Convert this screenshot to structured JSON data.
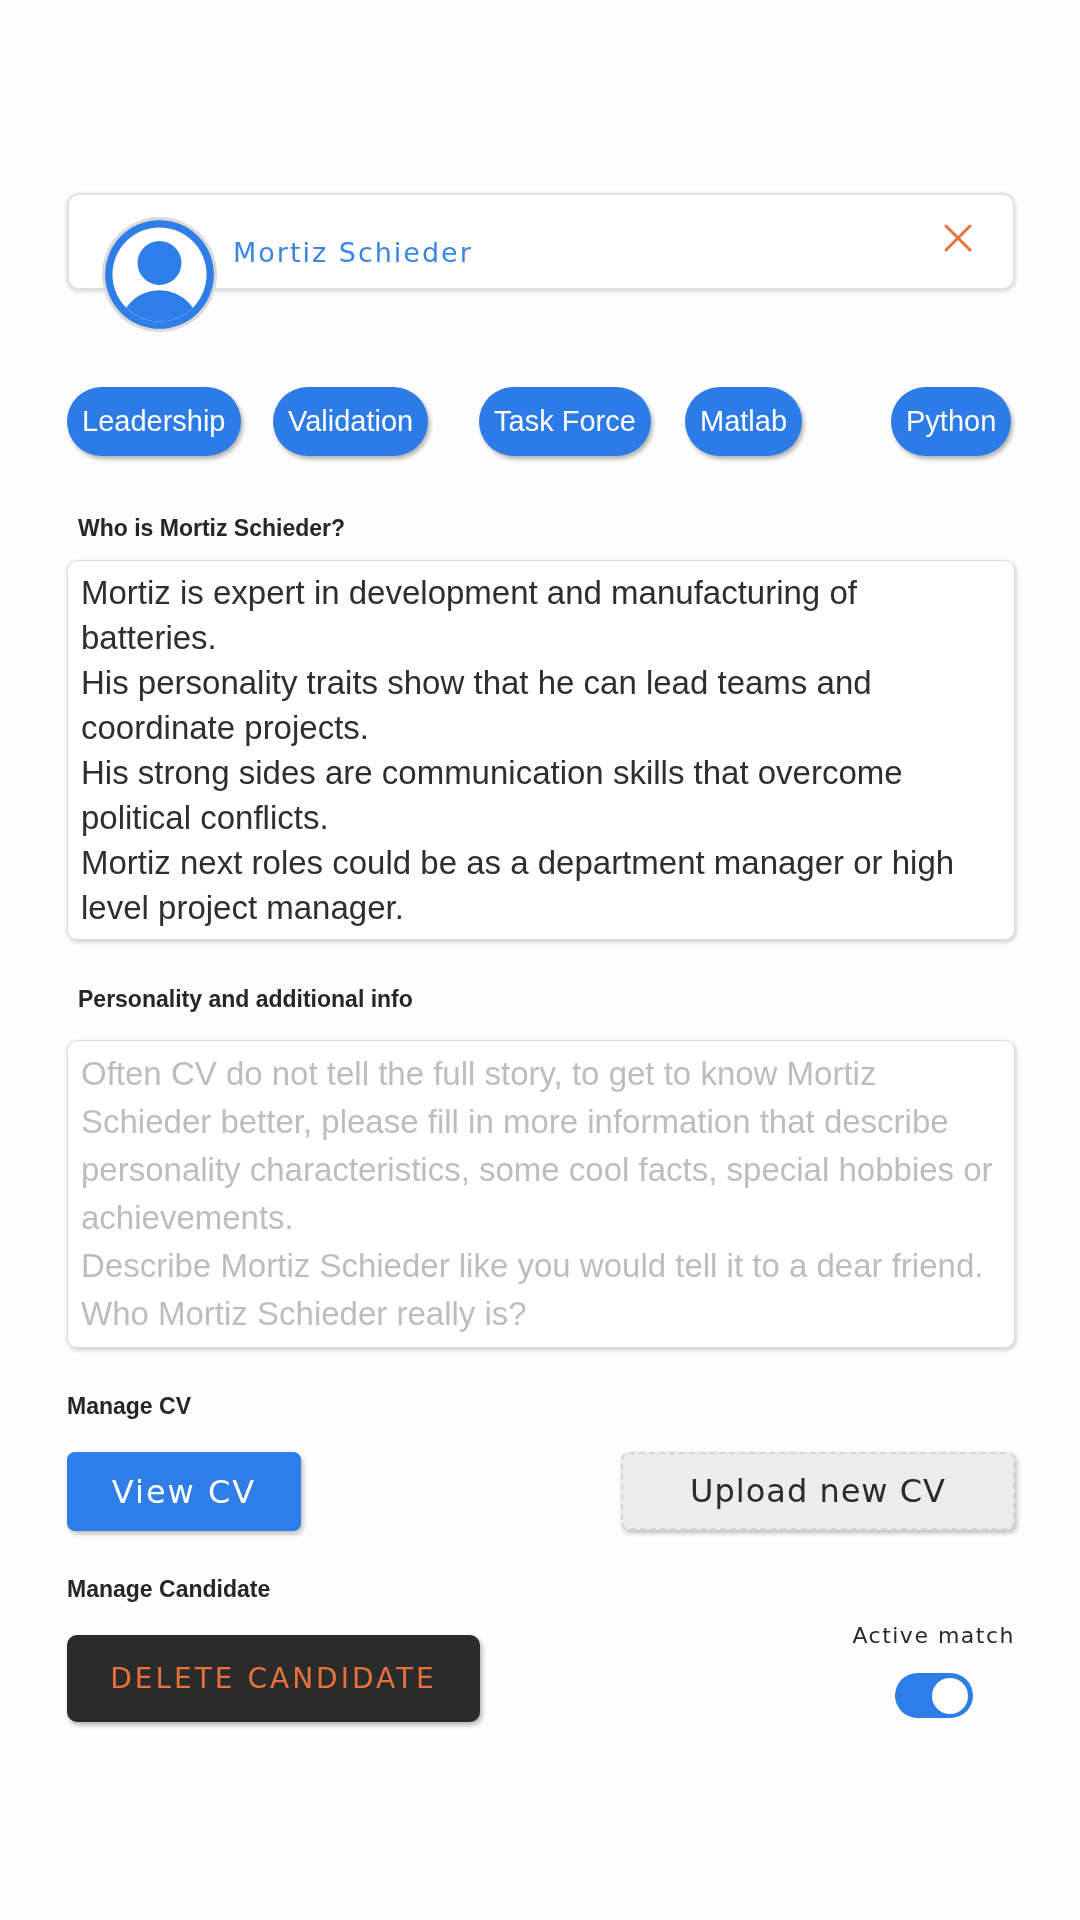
{
  "candidate_card": {
    "name": "Mortiz Schieder"
  },
  "skills": [
    "Leadership",
    "Validation",
    "Task Force",
    "Matlab",
    "Python"
  ],
  "summary": {
    "label": "Who is Mortiz Schieder?",
    "value": "Mortiz is expert in development and manufacturing of batteries.\nHis personality traits show that he can lead teams and coordinate projects.\nHis strong sides are communication skills that overcome political conflicts.\nMortiz next roles could be as a department manager or high level project manager."
  },
  "personality": {
    "label": "Personality and additional info",
    "placeholder": "Often CV do not tell the full story, to get to know Mortiz Schieder better, please fill in more information that describe personality characteristics, some cool facts, special hobbies or achievements.\nDescribe Mortiz Schieder like you would tell it to a dear friend. Who Mortiz Schieder really is?"
  },
  "manage_cv": {
    "label": "Manage CV",
    "buttons": [
      {
        "label": "View CV",
        "kind": "primary"
      },
      {
        "label": "Upload new CV",
        "kind": "secondary"
      }
    ]
  },
  "manage_candidate": {
    "label": "Manage Candidate",
    "delete_button": "DELETE CANDIDATE",
    "active_match": {
      "label": "Active match",
      "on": true
    }
  }
}
